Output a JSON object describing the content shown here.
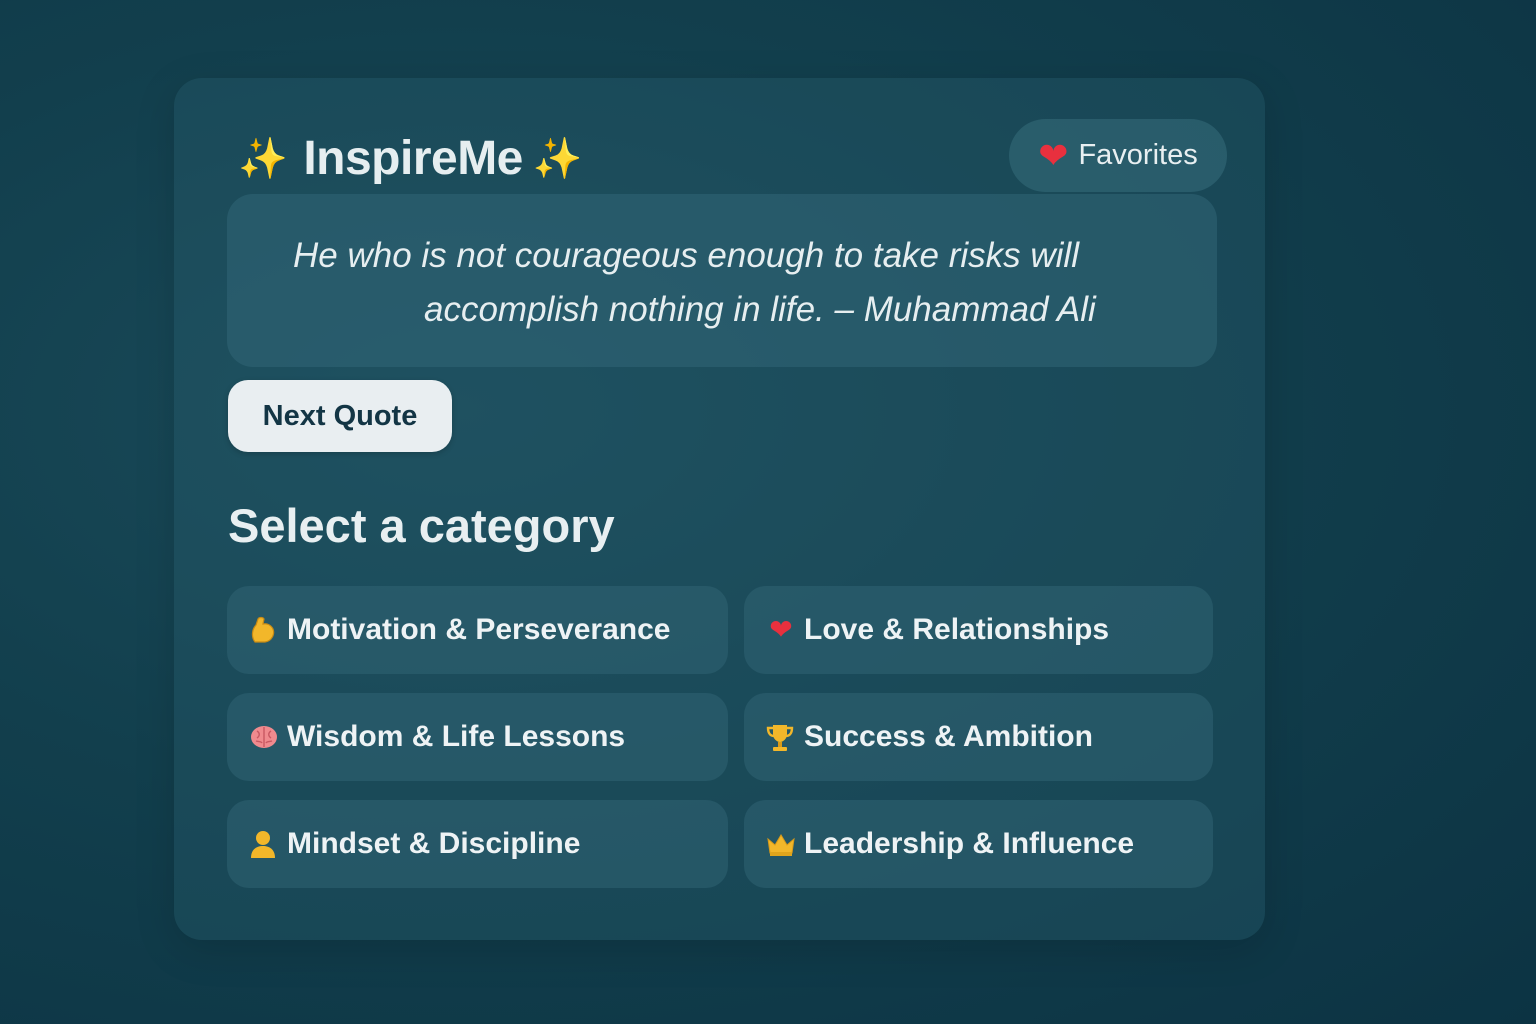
{
  "header": {
    "title": "InspireMe",
    "sparkle_left": "✨",
    "sparkle_right": "✨",
    "favorites_label": "Favorites"
  },
  "quote": {
    "line1": "He who is not courageous enough to take risks will",
    "line2": "accomplish nothing in life. – Muhammad Ali"
  },
  "next_button_label": "Next Quote",
  "categories_heading": "Select a category",
  "categories": [
    {
      "label": "Motivation & Perseverance",
      "icon": "flexed-bicep-icon"
    },
    {
      "label": "Love & Relationships",
      "icon": "heart-icon"
    },
    {
      "label": "Wisdom & Life Lessons",
      "icon": "brain-icon"
    },
    {
      "label": "Success & Ambition",
      "icon": "trophy-icon"
    },
    {
      "label": "Mindset & Discipline",
      "icon": "person-icon"
    },
    {
      "label": "Leadership & Influence",
      "icon": "crown-icon"
    }
  ],
  "colors": {
    "background": "#123f4d",
    "accent_heart": "#e8303e",
    "sparkle": "#f6d93a",
    "button_bg": "#e9eef1",
    "button_text": "#133545"
  }
}
